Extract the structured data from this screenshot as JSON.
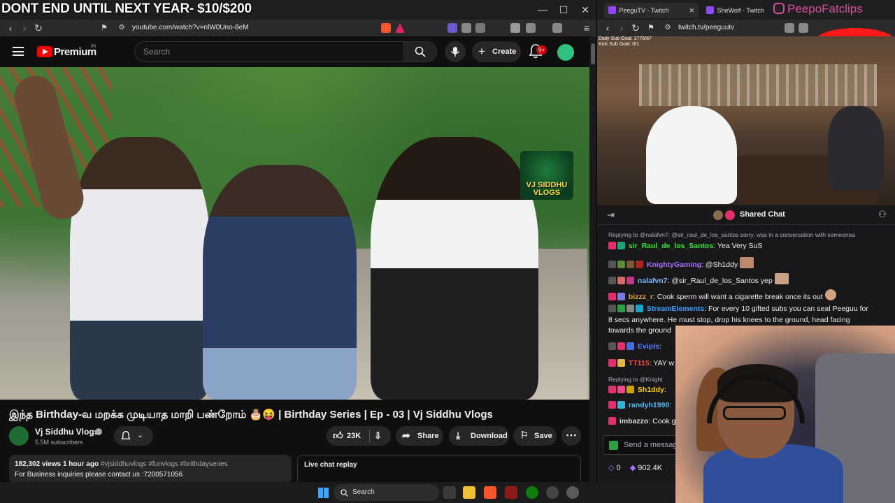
{
  "overlay": {
    "banner": "DONT END UNTIL NEXT YEAR- $10/$200"
  },
  "left_browser": {
    "url": "youtube.com/watch?v=nlW0Uno-8eM",
    "window_controls": {
      "minimize": "—",
      "maximize": "☐",
      "close": "✕"
    }
  },
  "youtube": {
    "header": {
      "brand": "Premium",
      "region": "IN",
      "search_placeholder": "Search",
      "create_label": "Create",
      "notif_count": "9+"
    },
    "video": {
      "badge_text": "VJ SIDDHU VLOGS",
      "title": "இந்த Birthday-வ மறக்க முடியாத மாறி பண்றோம் 🎂😝 | Birthday Series | Ep - 03 | Vj Siddhu Vlogs"
    },
    "channel": {
      "name": "Vj Siddhu Vlogs",
      "subscribers": "5.5M subscribers"
    },
    "actions": {
      "like_count": "23K",
      "share_label": "Share",
      "download_label": "Download",
      "save_label": "Save",
      "more_label": "⋯"
    },
    "description": {
      "views_time": "182,302 views  1 hour ago",
      "hashtags": " #vjsiddhuvlogs #funvlogs #brithdayseries",
      "first_line": "For Business inquiries please contact us :7200571056"
    },
    "live_chat_label": "Live chat replay"
  },
  "right_browser": {
    "tabs": [
      {
        "label": "PeeguTV - Twitch"
      },
      {
        "label": "SheWolf - Twitch"
      }
    ],
    "url": "twitch.tv/peeguutv",
    "watermark": "PeepoFatclips"
  },
  "twitch": {
    "stream_goal": "Daily Sub Goal: 1776/67\nKick Sub Goal: 0/1",
    "chat_title": "Shared Chat",
    "messages": [
      {
        "type": "reply",
        "text": "Replying to @nalafvn7: @sir_raul_de_los_santos sorry, was in a conversation with someonea"
      },
      {
        "user": "sir_Raul_de_los_Santos",
        "color": "#2ee82e",
        "text": ": Yea Very SuS"
      },
      {
        "user": "KnightyGaming",
        "color": "#a970ff",
        "text": ": @Sh1ddy"
      },
      {
        "user": "nalafvn7",
        "color": "#7ab8ff",
        "text": ": @sir_Raul_de_los_Santos yep"
      },
      {
        "user": "bizzz_r",
        "color": "#e0a32c",
        "text": ": Cook sperm will want a cigarette break once its out"
      },
      {
        "user": "StreamElements",
        "color": "#3aa0ff",
        "text": ": For every 10 gifted subs you can seal Peeguu for"
      },
      {
        "type": "cont",
        "text": "8 secs anywhere. He must stop, drop his knees to the ground, head facing"
      },
      {
        "type": "cont",
        "text": "towards the ground"
      },
      {
        "user": "Evipls",
        "color": "#5b7fff",
        "text": ":"
      },
      {
        "user": "TT115",
        "color": "#ff4a4a",
        "text": ": YAY w"
      },
      {
        "type": "reply",
        "text": "Replying to @Knight"
      },
      {
        "user": "Sh1ddy",
        "color": "#ffd000",
        "text": ":"
      },
      {
        "user": "randyh1990",
        "color": "#4ac0ff",
        "text": ":"
      },
      {
        "user": "imbazzo",
        "color": "#dcdcdc",
        "text": ": Cook g"
      }
    ],
    "input_placeholder": "Send a message",
    "viewers_left": "0",
    "viewers": "902.4K"
  },
  "taskbar": {
    "search_label": "Search"
  }
}
